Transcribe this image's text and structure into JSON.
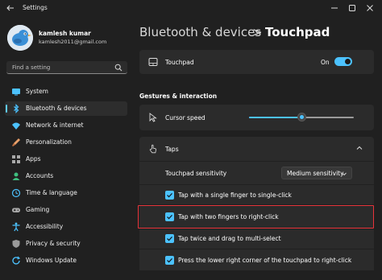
{
  "window": {
    "title": "Settings"
  },
  "profile": {
    "name": "kamlesh kumar",
    "email": "kamlesh2011@gmail.com"
  },
  "search": {
    "placeholder": "Find a setting"
  },
  "sidebar": {
    "items": [
      {
        "label": "System",
        "icon": "monitor-icon",
        "color": "#4cc2ff"
      },
      {
        "label": "Bluetooth & devices",
        "icon": "bluetooth-icon",
        "color": "#4cc2ff",
        "active": true
      },
      {
        "label": "Network & internet",
        "icon": "wifi-icon",
        "color": "#4cc2ff"
      },
      {
        "label": "Personalization",
        "icon": "paintbrush-icon",
        "color": "#e8a06b"
      },
      {
        "label": "Apps",
        "icon": "apps-icon",
        "color": "#a9a9a9"
      },
      {
        "label": "Accounts",
        "icon": "person-icon",
        "color": "#3fbf7f"
      },
      {
        "label": "Time & language",
        "icon": "globe-clock-icon",
        "color": "#4cc2ff"
      },
      {
        "label": "Gaming",
        "icon": "gamepad-icon",
        "color": "#a9a9a9"
      },
      {
        "label": "Accessibility",
        "icon": "accessibility-icon",
        "color": "#4cc2ff"
      },
      {
        "label": "Privacy & security",
        "icon": "shield-icon",
        "color": "#9a9a9a"
      },
      {
        "label": "Windows Update",
        "icon": "update-icon",
        "color": "#4cc2ff"
      }
    ]
  },
  "breadcrumb": {
    "parent": "Bluetooth & devices",
    "separator": ">",
    "current": "Touchpad"
  },
  "touchpad_card": {
    "label": "Touchpad",
    "toggle_state": "On",
    "toggle_on": true
  },
  "section": {
    "heading": "Gestures & interaction"
  },
  "cursor_speed": {
    "label": "Cursor speed",
    "value_fraction": 0.5
  },
  "taps": {
    "label": "Taps",
    "expanded": true,
    "sensitivity_label": "Touchpad sensitivity",
    "sensitivity_value": "Medium sensitivity",
    "options": [
      {
        "label": "Tap with a single finger to single-click",
        "checked": true
      },
      {
        "label": "Tap with two fingers to right-click",
        "checked": true,
        "highlighted": true
      },
      {
        "label": "Tap twice and drag to multi-select",
        "checked": true
      },
      {
        "label": "Press the lower right corner of the touchpad to right-click",
        "checked": true
      }
    ]
  },
  "colors": {
    "accent": "#4cc2ff",
    "highlight": "#e8343b",
    "background": "#202020",
    "card": "#2b2b2b"
  }
}
